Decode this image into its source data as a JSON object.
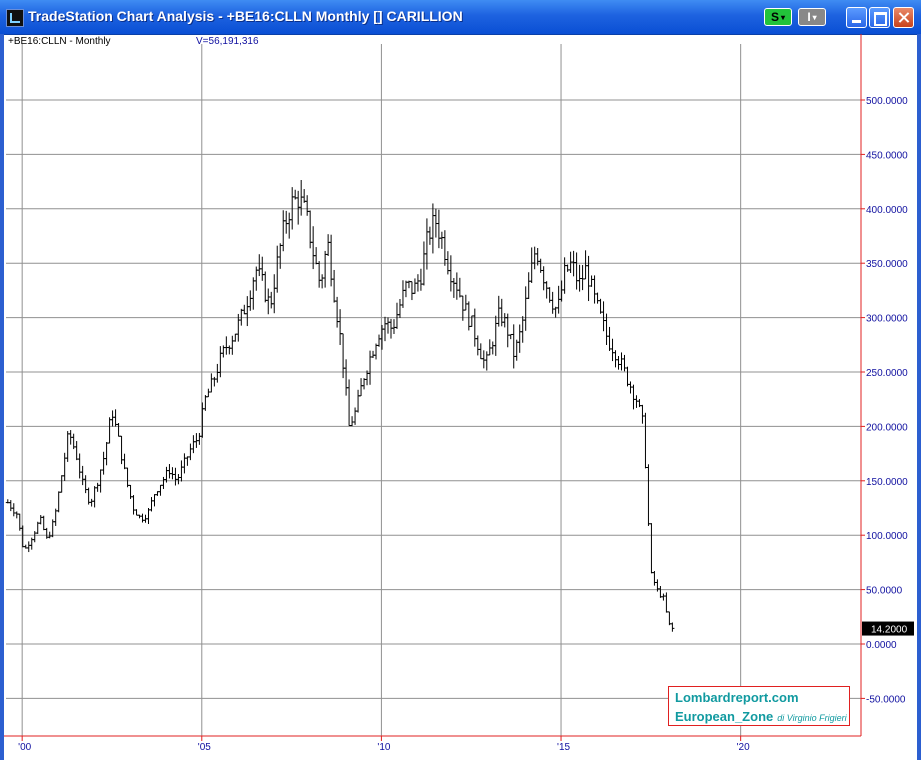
{
  "window": {
    "title": "TradeStation Chart Analysis - +BE16:CLLN Monthly [] CARILLION",
    "buttons": {
      "s_label": "S",
      "i_label": "I",
      "dropdown_glyph": "▾"
    }
  },
  "chart_header": {
    "symbol_label": "+BE16:CLLN - Monthly",
    "volume_label": "V=56,191,316"
  },
  "colors": {
    "grid": "#909090",
    "axis_line": "#e02020",
    "axis_text": "#1010a0",
    "bars": "#000000",
    "price_tag_bg": "#000000",
    "price_tag_text": "#ffffff",
    "watermark_text": "#119aa0",
    "watermark_border": "#e02020"
  },
  "last_price_label": "14.2000",
  "watermark": {
    "line1": "Lombardreport.com",
    "line2": "European_Zone",
    "line2_suffix": "di Virginio Frigieri"
  },
  "chart_data": {
    "type": "ohlc",
    "period": "monthly",
    "ylim": [
      -80,
      560
    ],
    "xlim": [
      1999.55,
      2006.0
    ],
    "y_ticks": [
      {
        "value": 500,
        "label": "500.0000"
      },
      {
        "value": 450,
        "label": "450.0000"
      },
      {
        "value": 400,
        "label": "400.0000"
      },
      {
        "value": 350,
        "label": "350.0000"
      },
      {
        "value": 300,
        "label": "300.0000"
      },
      {
        "value": 250,
        "label": "250.0000"
      },
      {
        "value": 200,
        "label": "200.0000"
      },
      {
        "value": 150,
        "label": "150.0000"
      },
      {
        "value": 100,
        "label": "100.0000"
      },
      {
        "value": 50,
        "label": "50.0000"
      },
      {
        "value": 0,
        "label": "0.0000"
      },
      {
        "value": -50,
        "label": "-50.0000"
      }
    ],
    "x_ticks": [
      {
        "value": 2000.0,
        "label": "'00"
      },
      {
        "value": 2005.0,
        "label": "'05"
      },
      {
        "value": 2010.0,
        "label": "'10"
      },
      {
        "value": 2015.0,
        "label": "'15"
      },
      {
        "value": 2020.0,
        "label": "'20"
      }
    ],
    "xlim_note": "",
    "x_range": [
      1999.55,
      2023.35
    ],
    "anchors": [
      [
        1999.6,
        130
      ],
      [
        1999.85,
        120
      ],
      [
        2000.05,
        85
      ],
      [
        2000.3,
        100
      ],
      [
        2000.5,
        115
      ],
      [
        2000.7,
        95
      ],
      [
        2000.9,
        115
      ],
      [
        2001.1,
        155
      ],
      [
        2001.3,
        195
      ],
      [
        2001.5,
        175
      ],
      [
        2001.7,
        145
      ],
      [
        2001.9,
        130
      ],
      [
        2002.1,
        150
      ],
      [
        2002.3,
        175
      ],
      [
        2002.5,
        215
      ],
      [
        2002.7,
        185
      ],
      [
        2002.9,
        150
      ],
      [
        2003.1,
        125
      ],
      [
        2003.3,
        115
      ],
      [
        2003.5,
        120
      ],
      [
        2003.7,
        140
      ],
      [
        2003.9,
        150
      ],
      [
        2004.1,
        160
      ],
      [
        2004.3,
        150
      ],
      [
        2004.5,
        165
      ],
      [
        2004.7,
        180
      ],
      [
        2004.9,
        190
      ],
      [
        2005.1,
        225
      ],
      [
        2005.3,
        240
      ],
      [
        2005.5,
        260
      ],
      [
        2005.7,
        275
      ],
      [
        2005.9,
        285
      ],
      [
        2006.1,
        300
      ],
      [
        2006.3,
        320
      ],
      [
        2006.5,
        345
      ],
      [
        2006.7,
        330
      ],
      [
        2006.9,
        310
      ],
      [
        2007.1,
        350
      ],
      [
        2007.3,
        385
      ],
      [
        2007.5,
        405
      ],
      [
        2007.7,
        410
      ],
      [
        2007.9,
        395
      ],
      [
        2008.1,
        360
      ],
      [
        2008.3,
        330
      ],
      [
        2008.5,
        370
      ],
      [
        2008.7,
        320
      ],
      [
        2008.9,
        270
      ],
      [
        2009.1,
        200
      ],
      [
        2009.3,
        215
      ],
      [
        2009.5,
        245
      ],
      [
        2009.7,
        265
      ],
      [
        2009.9,
        285
      ],
      [
        2010.1,
        295
      ],
      [
        2010.3,
        290
      ],
      [
        2010.5,
        310
      ],
      [
        2010.7,
        330
      ],
      [
        2010.9,
        325
      ],
      [
        2011.1,
        340
      ],
      [
        2011.3,
        375
      ],
      [
        2011.5,
        390
      ],
      [
        2011.7,
        370
      ],
      [
        2011.9,
        345
      ],
      [
        2012.1,
        330
      ],
      [
        2012.3,
        310
      ],
      [
        2012.5,
        295
      ],
      [
        2012.7,
        275
      ],
      [
        2012.9,
        255
      ],
      [
        2013.1,
        280
      ],
      [
        2013.3,
        305
      ],
      [
        2013.5,
        290
      ],
      [
        2013.7,
        265
      ],
      [
        2013.9,
        290
      ],
      [
        2014.1,
        330
      ],
      [
        2014.3,
        365
      ],
      [
        2014.5,
        340
      ],
      [
        2014.7,
        320
      ],
      [
        2014.9,
        305
      ],
      [
        2015.1,
        340
      ],
      [
        2015.3,
        350
      ],
      [
        2015.5,
        330
      ],
      [
        2015.7,
        345
      ],
      [
        2015.9,
        320
      ],
      [
        2016.1,
        300
      ],
      [
        2016.3,
        280
      ],
      [
        2016.5,
        270
      ],
      [
        2016.7,
        255
      ],
      [
        2016.9,
        240
      ],
      [
        2017.1,
        225
      ],
      [
        2017.3,
        200
      ],
      [
        2017.5,
        65
      ],
      [
        2017.7,
        48
      ],
      [
        2017.85,
        42
      ],
      [
        2018.0,
        18
      ],
      [
        2018.1,
        14
      ]
    ],
    "close": 14.2
  }
}
